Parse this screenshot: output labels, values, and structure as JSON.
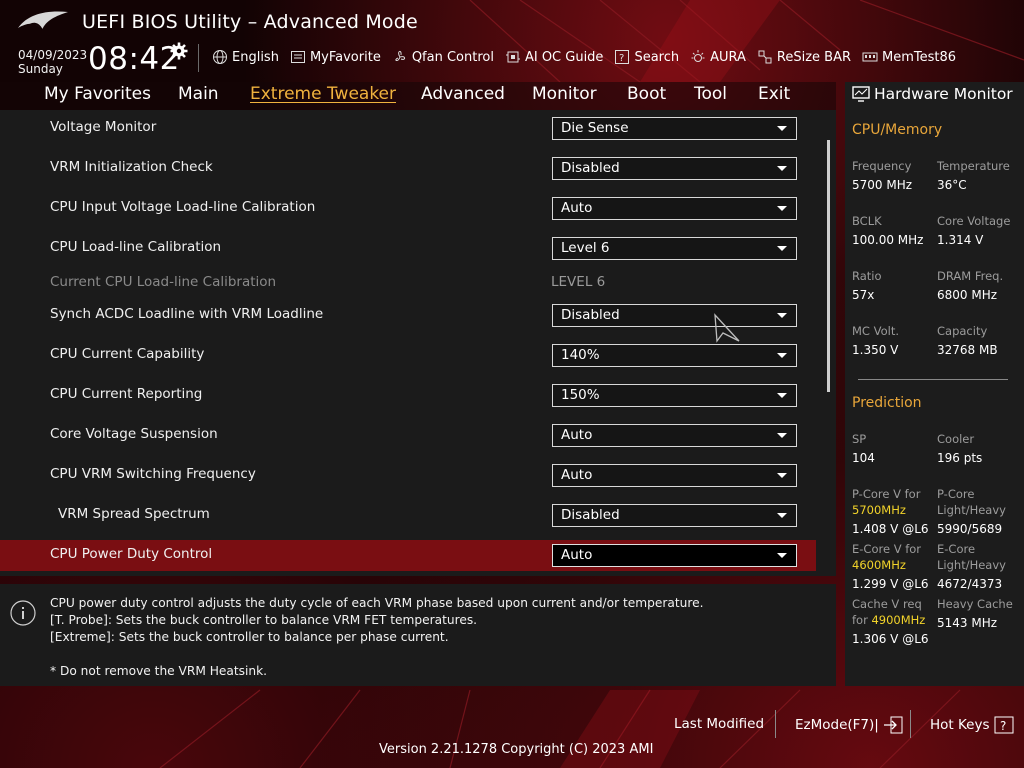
{
  "header": {
    "title": "UEFI BIOS Utility – Advanced Mode",
    "date": "04/09/2023",
    "day": "Sunday",
    "time": "08:42",
    "toolbar": [
      {
        "label": "English",
        "icon": "globe-icon"
      },
      {
        "label": "MyFavorite",
        "icon": "favorite-list-icon"
      },
      {
        "label": "Qfan Control",
        "icon": "fan-icon"
      },
      {
        "label": "AI OC Guide",
        "icon": "ai-chip-icon"
      },
      {
        "label": "Search",
        "icon": "search-box-icon"
      },
      {
        "label": "AURA",
        "icon": "aura-light-icon"
      },
      {
        "label": "ReSize BAR",
        "icon": "resize-bar-icon"
      },
      {
        "label": "MemTest86",
        "icon": "memory-icon"
      }
    ]
  },
  "nav": {
    "tabs": [
      "My Favorites",
      "Main",
      "Extreme Tweaker",
      "Advanced",
      "Monitor",
      "Boot",
      "Tool",
      "Exit"
    ],
    "active": "Extreme Tweaker"
  },
  "settings": [
    {
      "label": "Voltage Monitor",
      "value": "Die Sense"
    },
    {
      "label": "VRM Initialization Check",
      "value": "Disabled"
    },
    {
      "label": "CPU Input Voltage Load-line Calibration",
      "value": "Auto"
    },
    {
      "label": "CPU Load-line Calibration",
      "value": "Level 6"
    },
    {
      "label": "Current CPU Load-line Calibration",
      "value": "LEVEL 6"
    },
    {
      "label": "Synch ACDC Loadline with VRM Loadline",
      "value": "Disabled"
    },
    {
      "label": "CPU Current Capability",
      "value": "140%"
    },
    {
      "label": "CPU Current Reporting",
      "value": "150%"
    },
    {
      "label": "Core Voltage Suspension",
      "value": "Auto"
    },
    {
      "label": "CPU VRM Switching Frequency",
      "value": "Auto"
    },
    {
      "label": "VRM Spread Spectrum",
      "value": "Disabled"
    },
    {
      "label": "CPU Power Duty Control",
      "value": "Auto"
    }
  ],
  "help": {
    "lines": [
      "CPU power duty control adjusts the duty cycle of each VRM phase based upon current and/or temperature.",
      "[T. Probe]: Sets the buck controller to balance VRM FET temperatures.",
      "[Extreme]: Sets the buck controller to balance per phase current.",
      "* Do not remove the VRM Heatsink."
    ]
  },
  "hardware_monitor": {
    "title": "Hardware Monitor",
    "cpu_memory": {
      "heading": "CPU/Memory",
      "items": [
        {
          "label": "Frequency",
          "value": "5700 MHz"
        },
        {
          "label": "Temperature",
          "value": "36°C"
        },
        {
          "label": "BCLK",
          "value": "100.00 MHz"
        },
        {
          "label": "Core Voltage",
          "value": "1.314 V"
        },
        {
          "label": "Ratio",
          "value": "57x"
        },
        {
          "label": "DRAM Freq.",
          "value": "6800 MHz"
        },
        {
          "label": "MC Volt.",
          "value": "1.350 V"
        },
        {
          "label": "Capacity",
          "value": "32768 MB"
        }
      ]
    },
    "prediction": {
      "heading": "Prediction",
      "sp_label": "SP",
      "sp_value": "104",
      "cooler_label": "Cooler",
      "cooler_value": "196 pts",
      "pcore_label": "P-Core V for",
      "pcore_freq": "5700MHz",
      "pcore_value": "1.408 V @L6",
      "pcore_lh_label1": "P-Core",
      "pcore_lh_label2": "Light/Heavy",
      "pcore_lh_value": "5990/5689",
      "ecore_label": "E-Core V for",
      "ecore_freq": "4600MHz",
      "ecore_value": "1.299 V @L6",
      "ecore_lh_label1": "E-Core",
      "ecore_lh_label2": "Light/Heavy",
      "ecore_lh_value": "4672/4373",
      "cache_label1": "Cache V req",
      "cache_label2": "for",
      "cache_freq": "4900MHz",
      "cache_value": "1.306 V @L6",
      "heavy_cache_label": "Heavy Cache",
      "heavy_cache_value": "5143 MHz"
    }
  },
  "footer": {
    "last_modified": "Last Modified",
    "ezmode": "EzMode(F7)|",
    "hotkeys": "Hot Keys",
    "version": "Version 2.21.1278 Copyright (C) 2023 AMI"
  },
  "colors": {
    "accent": "#f0b23e",
    "selected_row": "#7a0e12",
    "highlight_value": "#f2d32a"
  }
}
